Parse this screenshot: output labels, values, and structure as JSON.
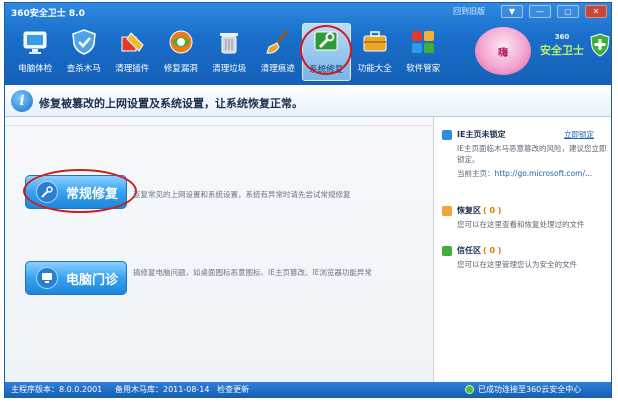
{
  "window": {
    "title": "360安全卫士 8.0",
    "old_version_link": "回到旧版",
    "controls": [
      "▼",
      "—",
      "▢",
      "✕"
    ]
  },
  "toolbar": {
    "items": [
      {
        "label": "电脑体检",
        "icon": "monitor-icon"
      },
      {
        "label": "查杀木马",
        "icon": "shield-scan-icon"
      },
      {
        "label": "清理插件",
        "icon": "broom-plugin-icon"
      },
      {
        "label": "修复漏洞",
        "icon": "patch-globe-icon"
      },
      {
        "label": "清理垃圾",
        "icon": "trash-can-icon"
      },
      {
        "label": "清理痕迹",
        "icon": "brush-icon"
      },
      {
        "label": "系统修复",
        "icon": "wrench-repair-icon",
        "active": true
      },
      {
        "label": "功能大全",
        "icon": "toolbox-icon"
      },
      {
        "label": "软件管家",
        "icon": "app-blocks-icon"
      }
    ],
    "mascot_text": "嗨",
    "brand_line1": "360",
    "brand_line2": "安全卫士"
  },
  "info": {
    "text": "修复被篡改的上网设置及系统设置，让系统恢复正常。"
  },
  "main": {
    "routine_repair": {
      "label": "常规修复",
      "description": "查复常见的上网设置和系统设置，系统有异常时请先尝试常规修复"
    },
    "pc_clinic": {
      "label": "电脑门诊",
      "description": "搞修复电脑问题，如桌面图标恶意图标、IE主页篡改、IE浏览器功能异常"
    }
  },
  "sidebar": {
    "ie_home": {
      "title": "IE主页未锁定",
      "action": "立即锁定",
      "text": "IE主页面临木马恶意篡改的风险，建议您立即锁定。",
      "current_label": "当前主页：",
      "current_url": "http://go.microsoft.com/..."
    },
    "restore": {
      "title": "恢复区",
      "count": "( 0 )",
      "text": "您可以在这里查看和恢复处理过的文件"
    },
    "trust": {
      "title": "信任区",
      "count": "( 0 )",
      "text": "您可以在这里管理您认为安全的文件"
    }
  },
  "status": {
    "version": "主程序版本：8.0.0.2001",
    "trojan_db": "备用木马库：2011-08-14",
    "check_update": "检查更新",
    "cloud": "已成功连接至360云安全中心"
  },
  "colors": {
    "accent": "#1a6fca",
    "button": "#37a2ee",
    "highlight_ring": "#d21b1b"
  }
}
